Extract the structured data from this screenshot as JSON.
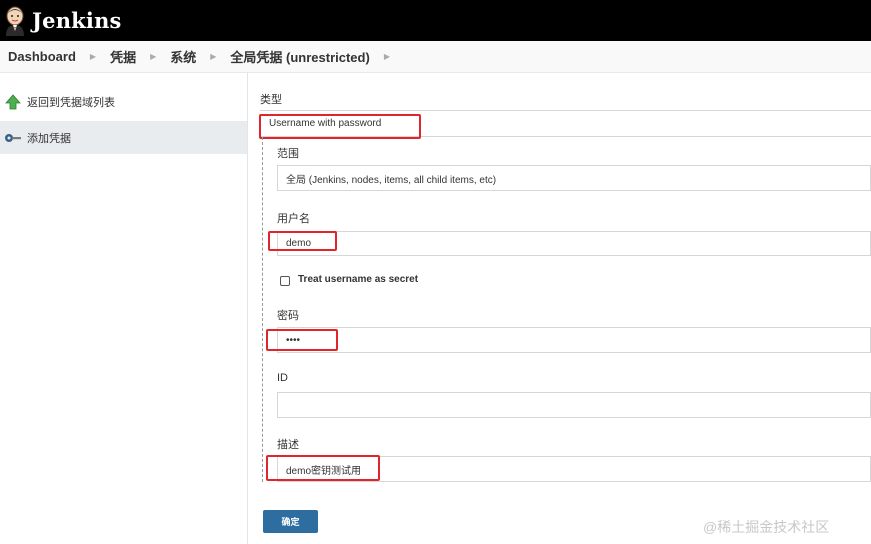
{
  "header": {
    "title": "Jenkins",
    "logo_icon": "jenkins-butler-icon"
  },
  "breadcrumb": {
    "items": [
      "Dashboard",
      "凭据",
      "系统",
      "全局凭据 (unrestricted)"
    ]
  },
  "sidebar": {
    "items": [
      {
        "label": "返回到凭据域列表",
        "icon": "green-up-arrow-icon"
      },
      {
        "label": "添加凭据",
        "icon": "key-icon"
      }
    ]
  },
  "form": {
    "type_label": "类型",
    "type_value": "Username with password",
    "scope_label": "范围",
    "scope_value": "全局 (Jenkins, nodes, items, all child items, etc)",
    "username_label": "用户名",
    "username_value": "demo",
    "secret_checkbox_label": "Treat username as secret",
    "password_label": "密码",
    "password_value": "••••",
    "id_label": "ID",
    "id_value": "",
    "description_label": "描述",
    "description_value": "demo密钥测试用",
    "submit_label": "确定"
  },
  "watermark": "@稀土掘金技术社区",
  "colors": {
    "header_bg": "#000000",
    "button_bg": "#2d6d9f",
    "highlight_red": "#e0262b"
  }
}
